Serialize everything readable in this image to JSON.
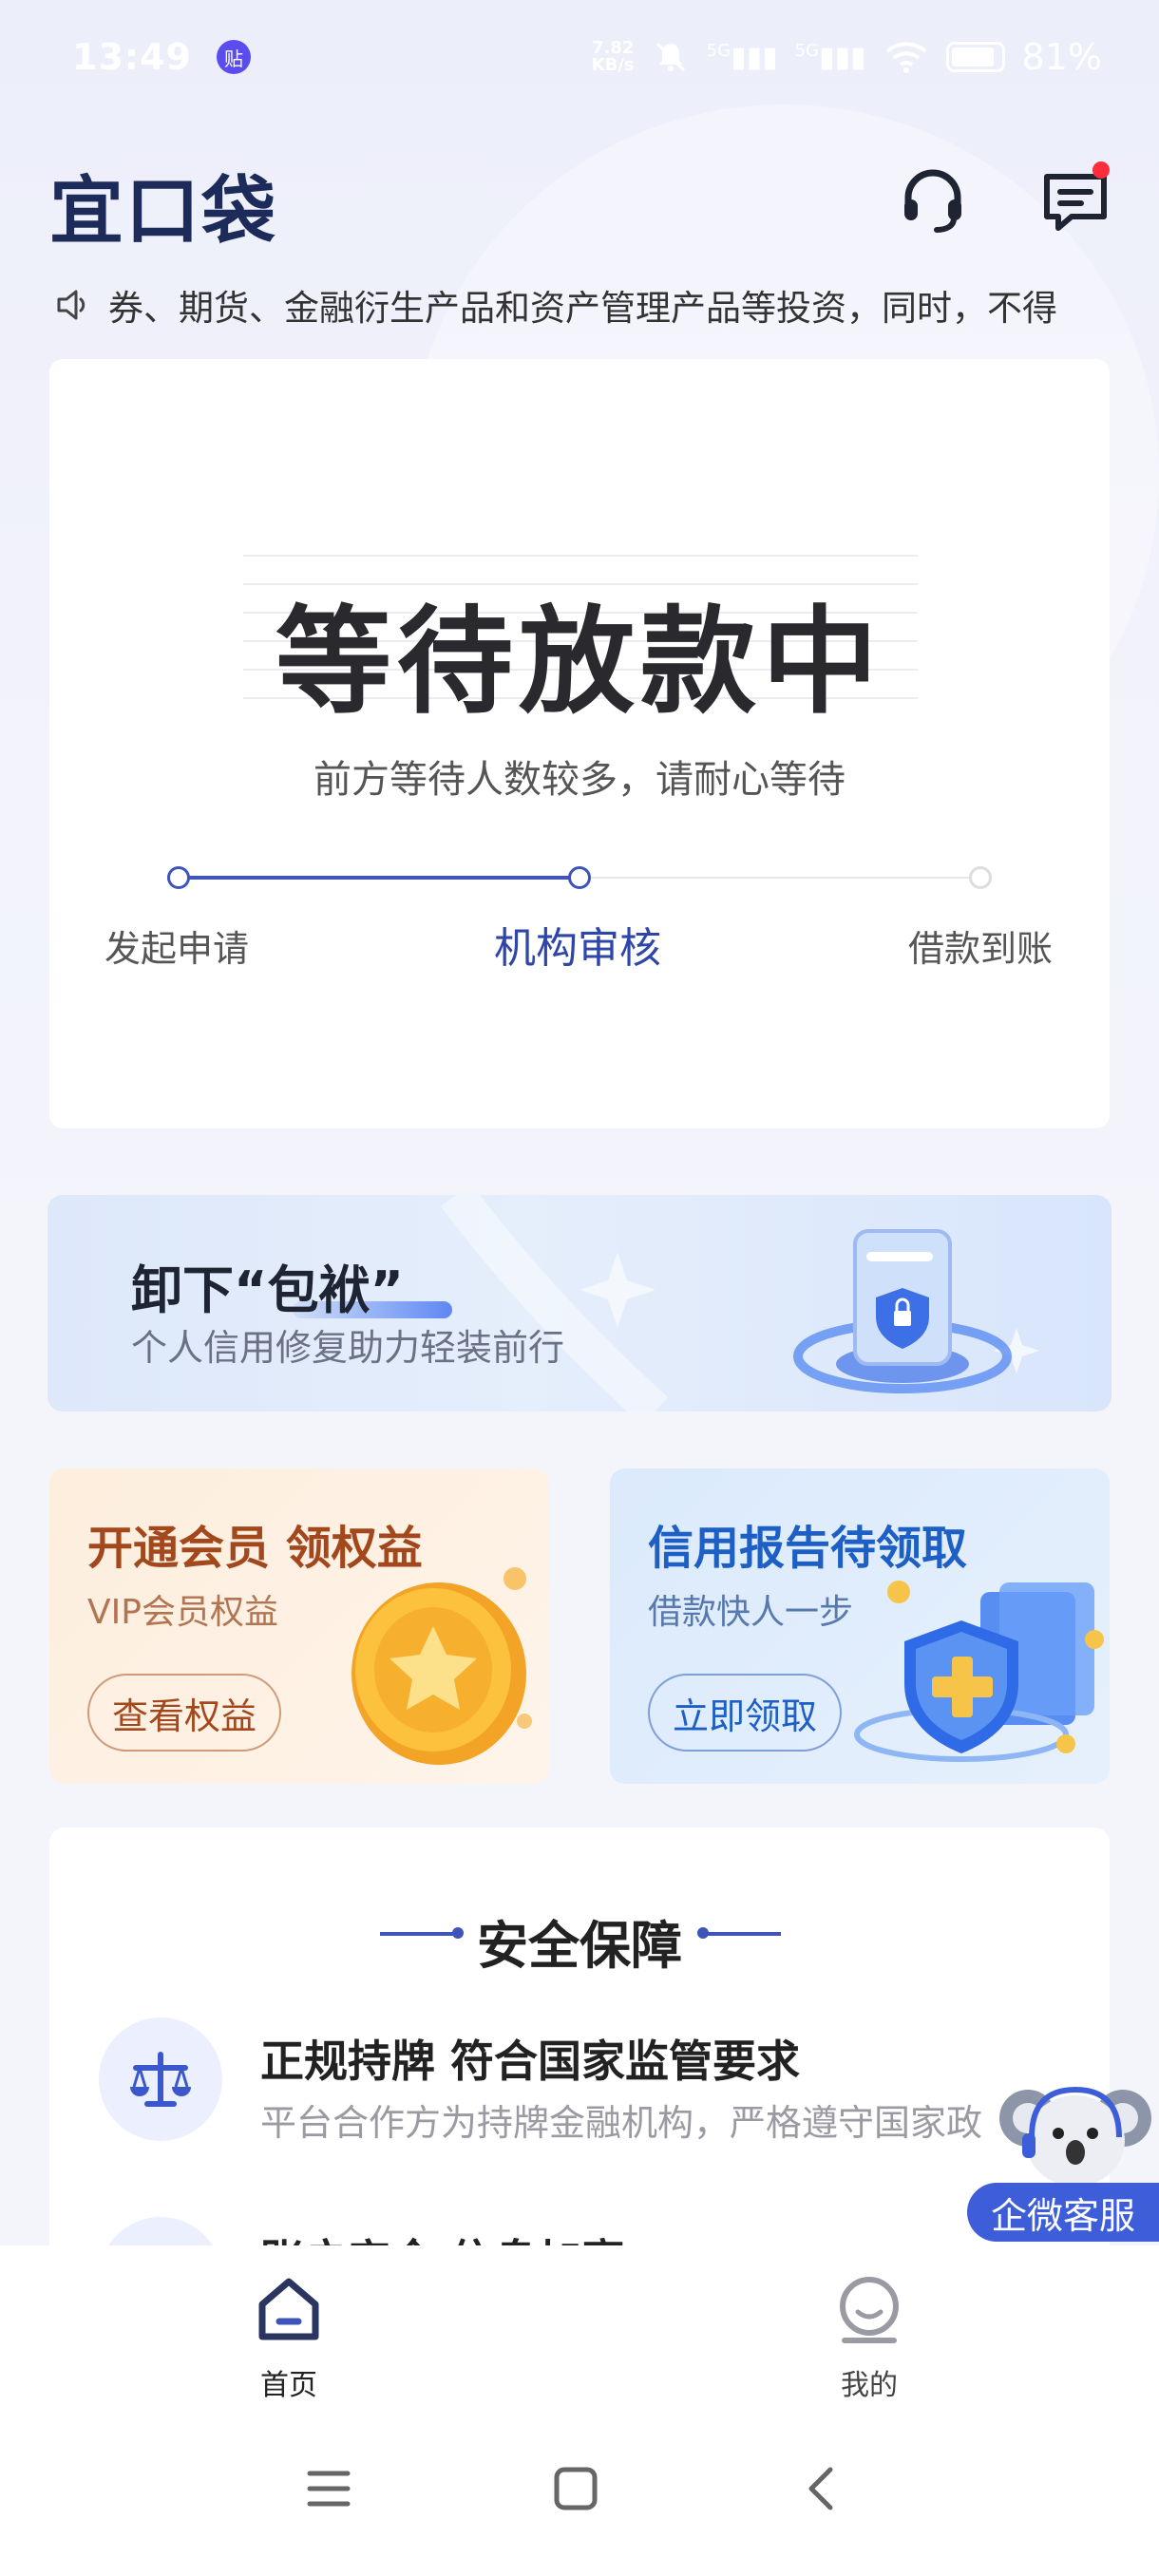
{
  "status_bar": {
    "time": "13:49",
    "app_badge": "贴",
    "net_speed": "7.82",
    "net_unit": "KB/s",
    "sig1": "5G",
    "sig2": "5G",
    "battery": "81%"
  },
  "header": {
    "logo": "宜口袋",
    "support_icon": "headset-icon",
    "message_icon": "message-icon"
  },
  "notice": {
    "text": "券、期货、金融衍生产品和资产管理产品等投资，同时，不得"
  },
  "status_card": {
    "title": "等待放款中",
    "subtitle": "前方等待人数较多，请耐心等待",
    "steps": [
      {
        "label": "发起申请",
        "state": "done"
      },
      {
        "label": "机构审核",
        "state": "current"
      },
      {
        "label": "借款到账",
        "state": "pending"
      }
    ]
  },
  "banner": {
    "title": "卸下“包袱”",
    "subtitle": "个人信用修复助力轻装前行"
  },
  "promos": {
    "vip": {
      "title": "开通会员 领权益",
      "subtitle": "VIP会员权益",
      "button": "查看权益"
    },
    "credit": {
      "title": "信用报告待领取",
      "subtitle": "借款快人一步",
      "button": "立即领取"
    }
  },
  "security": {
    "title": "安全保障",
    "items": [
      {
        "title": "正规持牌 符合国家监管要求",
        "desc": "平台合作方为持牌金融机构，严格遵守国家政",
        "icon": "balance-scale-icon"
      },
      {
        "title": "账户安全 信息加密",
        "desc": "",
        "icon": "shield-icon"
      }
    ]
  },
  "floating_service": {
    "label": "企微客服"
  },
  "bottom_nav": {
    "items": [
      {
        "label": "首页",
        "icon": "home-icon",
        "active": true
      },
      {
        "label": "我的",
        "icon": "profile-icon",
        "active": false
      }
    ]
  },
  "colors": {
    "primary": "#3d54b8",
    "vip_accent": "#a3481c",
    "credit_accent": "#1d5fc4",
    "float_bg": "#3d5ed8"
  }
}
